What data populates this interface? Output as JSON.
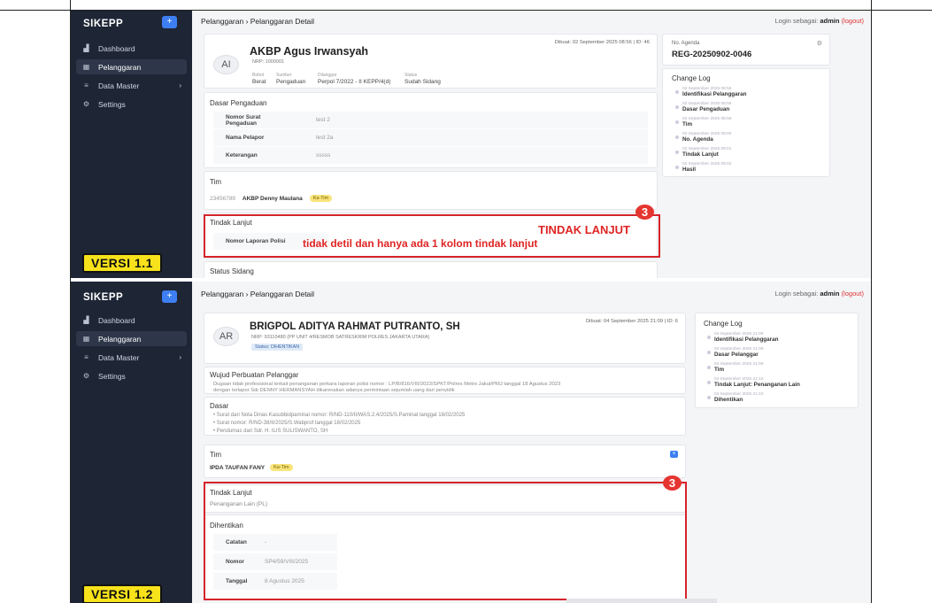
{
  "v1": {
    "sidebar": {
      "brand": "SIKEPP",
      "items": [
        {
          "icon": "dashboard-icon",
          "label": "Dashboard"
        },
        {
          "icon": "table-icon",
          "label": "Pelanggaran"
        },
        {
          "icon": "list-icon",
          "label": "Data Master"
        },
        {
          "icon": "gear-icon",
          "label": "Settings"
        }
      ]
    },
    "version_label": "VERSI 1.1",
    "breadcrumb": "Pelanggaran › Pelanggaran Detail",
    "login": {
      "prefix": "Login sebagai:",
      "user": "admin",
      "logout": "(logout)"
    },
    "profile": {
      "initials": "AI",
      "name": "AKBP Agus Irwansyah",
      "nrp": "NRP: 1000001",
      "created": "Dibuat: 02 September 2025 08:56 | ID: 46",
      "meta": [
        {
          "label": "Bobot",
          "value": "Berat"
        },
        {
          "label": "Sumber",
          "value": "Pengaduan"
        },
        {
          "label": "Dilanggar",
          "value": "Perpol 7/2022 - II KEPP/4(d)"
        },
        {
          "label": "Status",
          "value": "Sudah Sidang"
        }
      ]
    },
    "agenda": {
      "label": "No. Agenda",
      "value": "REG-20250902-0046"
    },
    "dasar": {
      "title": "Dasar Pengaduan",
      "rows": [
        {
          "key": "Nomor Surat Pengaduan",
          "value": "test 2"
        },
        {
          "key": "Nama Pelapor",
          "value": "test 2a"
        },
        {
          "key": "Keterangan",
          "value": "sssss"
        }
      ]
    },
    "tim": {
      "title": "Tim",
      "nrp": "23456789",
      "name": "AKBP Denny Maulana",
      "role": "Ka-Tim"
    },
    "tindak": {
      "title": "Tindak Lanjut",
      "key": "Nomor Laporan Polisi"
    },
    "annotation": {
      "number": "3",
      "heading": "TINDAK LANJUT",
      "note": "tidak detil dan hanya ada 1 kolom tindak lanjut"
    },
    "status_sidang": "Status Sidang",
    "changelog": {
      "title": "Change Log",
      "items": [
        {
          "date": "02 September 2025 08:56",
          "name": "Identifikasi Pelanggaran"
        },
        {
          "date": "02 September 2025 08:56",
          "name": "Dasar Pengaduan"
        },
        {
          "date": "02 September 2025 08:59",
          "name": "Tim"
        },
        {
          "date": "02 September 2025 09:00",
          "name": "No. Agenda"
        },
        {
          "date": "02 September 2025 09:01",
          "name": "Tindak Lanjut"
        },
        {
          "date": "02 September 2025 09:02",
          "name": "Hasil"
        }
      ]
    }
  },
  "v2": {
    "sidebar": {
      "brand": "SIKEPP",
      "items": [
        {
          "icon": "dashboard-icon",
          "label": "Dashboard"
        },
        {
          "icon": "table-icon",
          "label": "Pelanggaran"
        },
        {
          "icon": "list-icon",
          "label": "Data Master"
        },
        {
          "icon": "gear-icon",
          "label": "Settings"
        }
      ]
    },
    "version_label": "VERSI 1.2",
    "breadcrumb": "Pelanggaran › Pelanggaran Detail",
    "login": {
      "prefix": "Login sebagai:",
      "user": "admin",
      "logout": "(logout)"
    },
    "profile": {
      "initials": "AR",
      "name": "BRIGPOL ADITYA RAHMAT PUTRANTO, SH",
      "nrp": "NRP: 93110480 (PP UNIT 4/RESMOB SATRESKRIM POLRES JAKARTA UTARA)",
      "status": "Status: DIHENTIKAN",
      "created": "Dibuat: 04 September 2025 21:09 | ID: 6"
    },
    "wujud": {
      "title": "Wujud Perbuatan Pelanggar",
      "text1": "Dugaan tidak professional terkait penanganan perkara laporan polisi nomor : LP/B/816/VIII/2023/SPKT/Polres Metro Jakut/PMJ tanggal 18 Agustus 2023",
      "text2": "dengan terlapor Sdr.DENNY HERMANSYAH dikarenakan adanya permintaan sejumlah uang dari penyidik"
    },
    "dasar": {
      "title": "Dasar",
      "items": [
        "Surat dari Nota Dinas Kasubbidpaminal nomor: R/ND-110/II/WAS.2.4/2025/S.Paminal tanggal 18/02/2025",
        "Surat nomor: R/ND-38/II/2025/S.Wabprof tanggal 18/02/2025",
        "Pendumas dari Sdr. H. ILIS SULISWANTO, SH"
      ]
    },
    "tim": {
      "title": "Tim",
      "name": "IPDA TAUFAN FANY",
      "role": "Ka-Tim"
    },
    "tindak": {
      "title": "Tindak Lanjut",
      "value": "Penanganan Lain (PL)"
    },
    "annotation": {
      "number": "3"
    },
    "dihentikan": {
      "title": "Dihentikan",
      "rows": [
        {
          "key": "Catatan",
          "value": "-"
        },
        {
          "key": "Nomor",
          "value": "SP4/59/VIII/2025"
        },
        {
          "key": "Tanggal",
          "value": "8 Agustus 2025"
        }
      ]
    },
    "changelog": {
      "title": "Change Log",
      "items": [
        {
          "date": "04 September 2025 21:09",
          "name": "Identifikasi Pelanggaran"
        },
        {
          "date": "04 September 2025 21:09",
          "name": "Dasar Pelanggar"
        },
        {
          "date": "04 September 2025 21:09",
          "name": "Tim"
        },
        {
          "date": "04 September 2025 21:10",
          "name": "Tindak Lanjut: Penanganan Lain"
        },
        {
          "date": "04 September 2025 21:10",
          "name": "Dihentikan"
        }
      ]
    }
  },
  "colors": {
    "sidebar": "#1e2535",
    "accent": "#3d7ff2",
    "annotation_red": "#e02424",
    "badge_yellow": "#f8e47a",
    "version_yellow": "#f7e21b"
  }
}
